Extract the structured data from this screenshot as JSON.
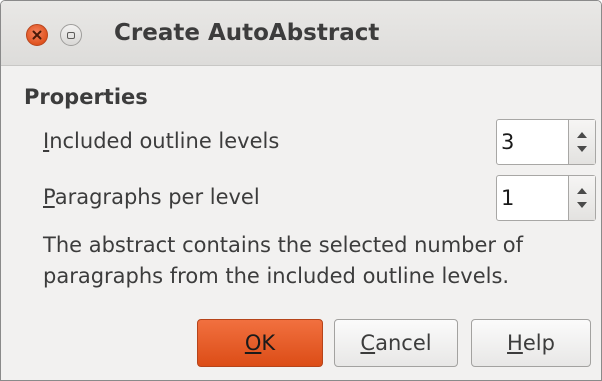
{
  "window": {
    "title": "Create AutoAbstract"
  },
  "properties": {
    "section_title": "Properties",
    "outline_levels": {
      "mnemonic": "I",
      "label_rest": "ncluded outline levels",
      "value": "3"
    },
    "paragraphs_per_level": {
      "mnemonic": "P",
      "label_rest": "aragraphs per level",
      "value": "1"
    },
    "description_line1": "The abstract contains the selected number of",
    "description_line2": "paragraphs from the included outline levels."
  },
  "buttons": {
    "ok": {
      "mnemonic": "O",
      "rest": "K"
    },
    "cancel": {
      "mnemonic": "C",
      "rest": "ancel"
    },
    "help": {
      "mnemonic": "H",
      "rest": "elp"
    }
  },
  "colors": {
    "accent": "#e45a22",
    "dialog_bg": "#f2f1f0",
    "text": "#3c3c3c"
  },
  "icons": {
    "close": "close-icon",
    "maximize": "maximize-icon",
    "spin_up": "arrow-up-icon",
    "spin_down": "arrow-down-icon"
  }
}
